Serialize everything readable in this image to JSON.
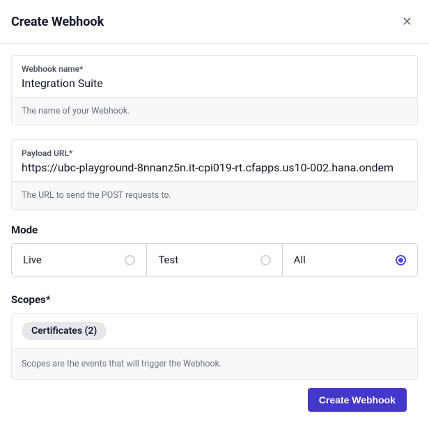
{
  "header": {
    "title": "Create Webhook"
  },
  "webhook_name": {
    "label": "Webhook name*",
    "value": "Integration Suite",
    "hint": "The name of your Webhook."
  },
  "payload_url": {
    "label": "Payload URL*",
    "value": "https://ubc-playground-8nnanz5n.it-cpi019-rt.cfapps.us10-002.hana.ondem",
    "hint": "The URL to send the POST requests to."
  },
  "mode": {
    "label": "Mode",
    "options": [
      {
        "label": "Live",
        "selected": false
      },
      {
        "label": "Test",
        "selected": false
      },
      {
        "label": "All",
        "selected": true
      }
    ]
  },
  "scopes": {
    "label": "Scopes*",
    "pill": "Certificates (2)",
    "hint": "Scopes are the events that will trigger the Webhook."
  },
  "submit": {
    "label": "Create Webhook"
  }
}
